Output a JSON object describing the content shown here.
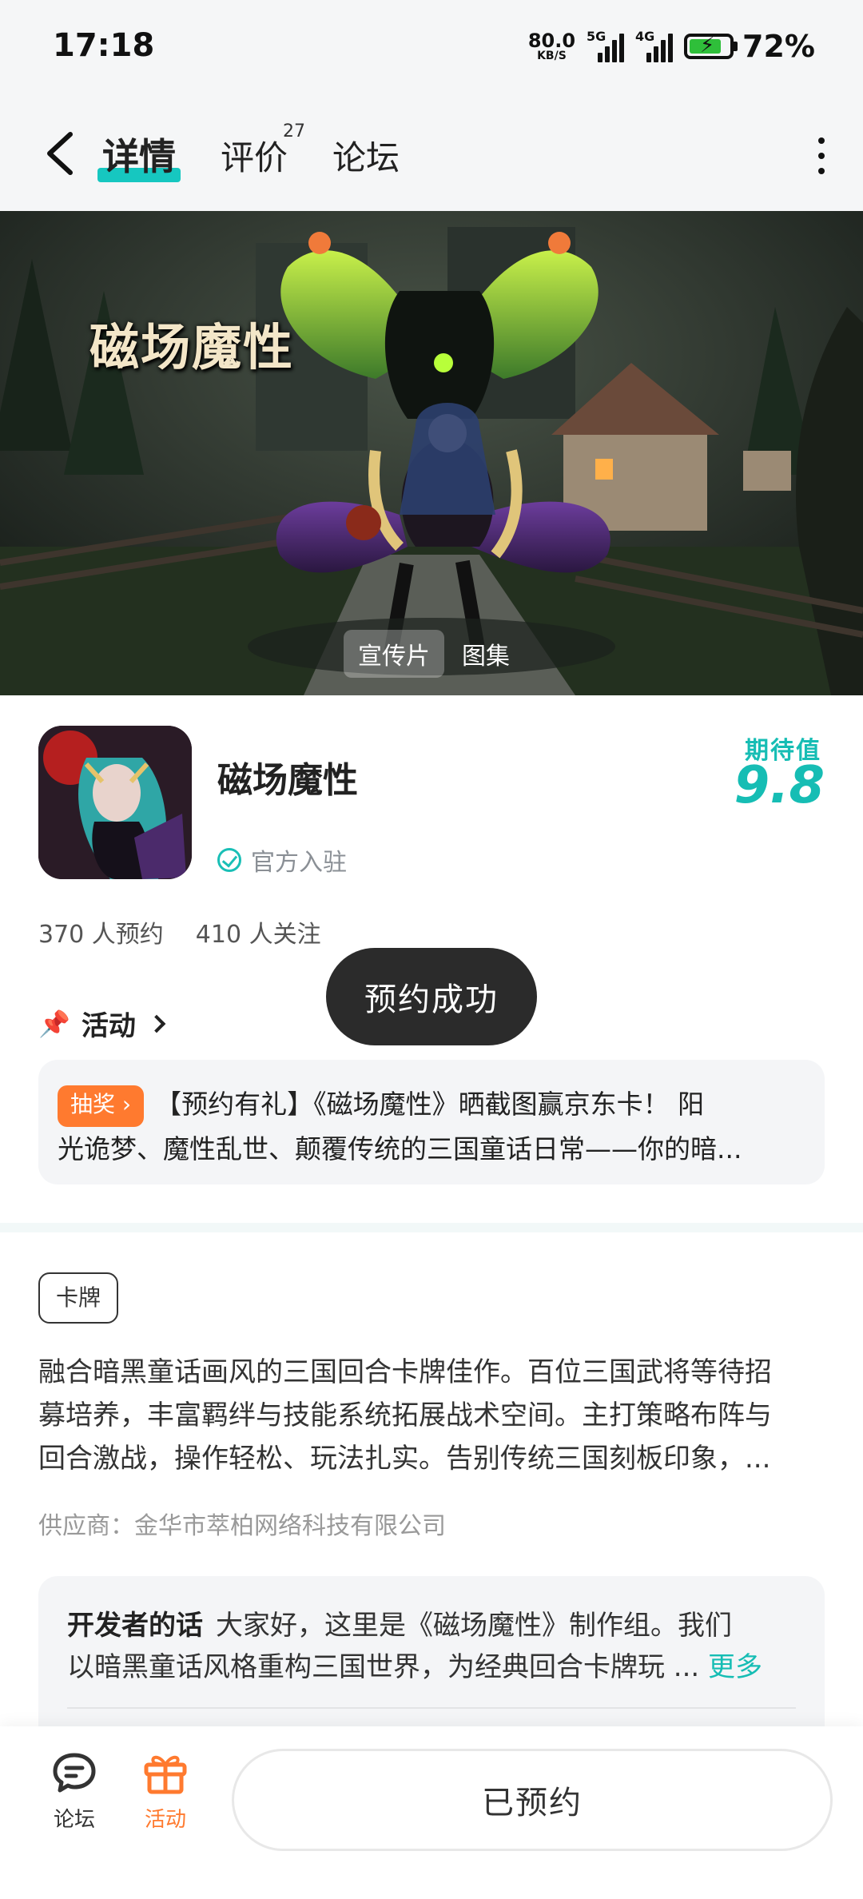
{
  "status_bar": {
    "time": "17:18",
    "net_speed_value": "80.0",
    "net_speed_unit": "KB/S",
    "sim1_tag": "5G",
    "sim2_tag": "4G",
    "battery_percent": "72%"
  },
  "nav": {
    "tabs": [
      {
        "label": "详情"
      },
      {
        "label": "评价",
        "count": "27"
      },
      {
        "label": "论坛"
      }
    ]
  },
  "banner": {
    "title": "磁场魔性",
    "media_tabs": [
      "宣传片",
      "图集"
    ]
  },
  "game": {
    "name": "磁场魔性",
    "official_label": "官方入驻",
    "expect_label": "期待值",
    "expect_score": "9.8",
    "stats": {
      "reserved": "370 人预约",
      "followers": "410 人关注"
    }
  },
  "toast": {
    "text": "预约成功"
  },
  "activity": {
    "header": "活动",
    "badge": "抽奖",
    "text_line1": "【预约有礼】《磁场魔性》晒截图赢京东卡！ 阳",
    "text_line2": "光诡梦、魔性乱世、颠覆传统的三国童话日常——你的暗..."
  },
  "details": {
    "tag": "卡牌",
    "desc_line1": "融合暗黑童话画风的三国回合卡牌佳作。百位三国武将等待招",
    "desc_line2": "募培养，丰富羁绊与技能系统拓展战术空间。主打策略布阵与",
    "desc_line3": "回合激战，操作轻松、玩法扎实。告别传统三国刻板印象，...",
    "supplier": "供应商：金华市萃柏网络科技有限公司"
  },
  "developer": {
    "title": "开发者的话",
    "line1": "大家好，这里是《磁场魔性》制作组。我们",
    "line2": "以暗黑童话风格重构三国世界，为经典回合卡牌玩 ...",
    "more": "更多"
  },
  "bottom_bar": {
    "forum_label": "论坛",
    "activity_label": "活动",
    "reserve_button": "已预约"
  },
  "colors": {
    "accent_teal": "#16bdb4",
    "accent_orange": "#ff7a2f",
    "toast_bg": "#2b2b2b"
  }
}
